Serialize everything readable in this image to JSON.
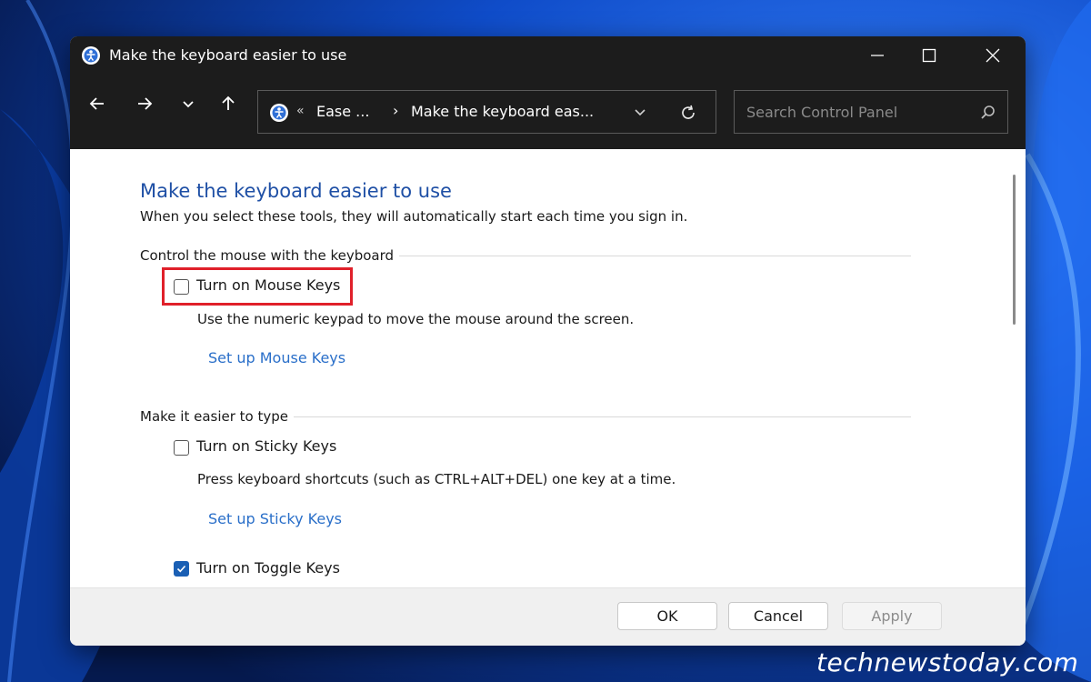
{
  "window": {
    "title": "Make the keyboard easier to use"
  },
  "navigation": {
    "breadcrumb_chevrons": "«",
    "breadcrumb_parent": "Ease ...",
    "breadcrumb_separator": "›",
    "breadcrumb_current": "Make the keyboard eas..."
  },
  "search": {
    "placeholder": "Search Control Panel"
  },
  "page": {
    "title": "Make the keyboard easier to use",
    "description": "When you select these tools, they will automatically start each time you sign in."
  },
  "sections": [
    {
      "label": "Control the mouse with the keyboard",
      "options": [
        {
          "label": "Turn on Mouse Keys",
          "checked": false,
          "highlighted": true,
          "description": "Use the numeric keypad to move the mouse around the screen.",
          "link": "Set up Mouse Keys"
        }
      ]
    },
    {
      "label": "Make it easier to type",
      "options": [
        {
          "label": "Turn on Sticky Keys",
          "checked": false,
          "description": "Press keyboard shortcuts (such as CTRL+ALT+DEL) one key at a time.",
          "link": "Set up Sticky Keys"
        },
        {
          "label": "Turn on Toggle Keys",
          "checked": true
        }
      ]
    }
  ],
  "footer": {
    "ok": "OK",
    "cancel": "Cancel",
    "apply": "Apply"
  },
  "watermark": "technewstoday.com",
  "colors": {
    "accent": "#1a5fb4",
    "link": "#2a6fc9",
    "heading": "#1e4fa5",
    "highlight": "#e0202a",
    "titlebar": "#1c1c1c"
  }
}
